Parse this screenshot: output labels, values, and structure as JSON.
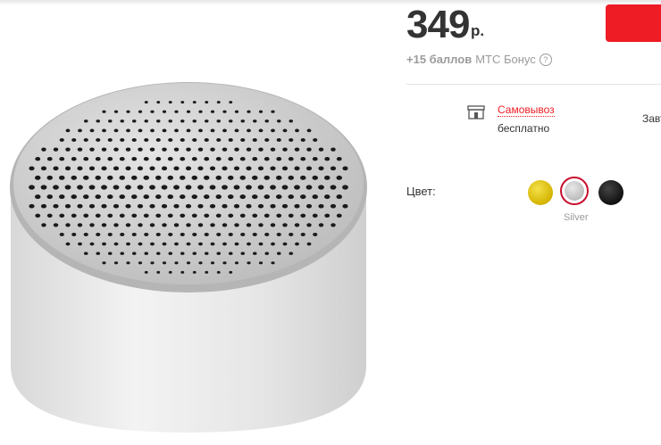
{
  "price": {
    "value": "349",
    "currency": "р."
  },
  "bonus": {
    "points": "+15 баллов",
    "program": "МТС Бонус",
    "help_glyph": "?"
  },
  "delivery": {
    "pickup_label": "Самовывоз",
    "pickup_price": "бесплатно",
    "other_label": "Завт"
  },
  "color": {
    "label": "Цвет:",
    "selected": "Silver",
    "options": [
      "yellow",
      "silver",
      "black"
    ]
  },
  "colors": {
    "accent": "#ee1c25",
    "muted": "#9a9a9a"
  }
}
